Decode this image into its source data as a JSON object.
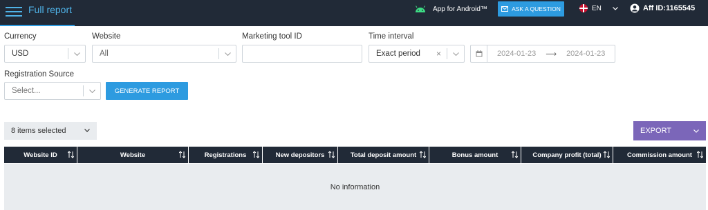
{
  "header": {
    "title": "Full report",
    "android_label": "App for Android™",
    "ask_label": "ASK A QUESTION",
    "language": "EN",
    "aff_id": "Aff ID:1165545"
  },
  "filters": {
    "currency": {
      "label": "Currency",
      "value": "USD"
    },
    "website": {
      "label": "Website",
      "value": "All"
    },
    "marketing_tool": {
      "label": "Marketing tool ID",
      "value": ""
    },
    "time_interval": {
      "label": "Time interval",
      "value": "Exact period",
      "clear": "×"
    },
    "date_from": "2024-01-23",
    "date_arrow": "⟶",
    "date_to": "2024-01-23",
    "registration_source": {
      "label": "Registration Source",
      "placeholder": "Select..."
    },
    "generate_label": "GENERATE REPORT"
  },
  "toolbar": {
    "items_selected": "8 items selected",
    "export_label": "EXPORT"
  },
  "table": {
    "columns": [
      "Website ID",
      "Website",
      "Registrations",
      "New depositors",
      "Total deposit amount",
      "Bonus amount",
      "Company profit (total)",
      "Commission amount"
    ],
    "empty_text": "No information"
  },
  "colors": {
    "topbar": "#212a37",
    "accent_blue": "#2d9be0",
    "export_purple": "#7b66b9",
    "android_green": "#3ddc84"
  }
}
